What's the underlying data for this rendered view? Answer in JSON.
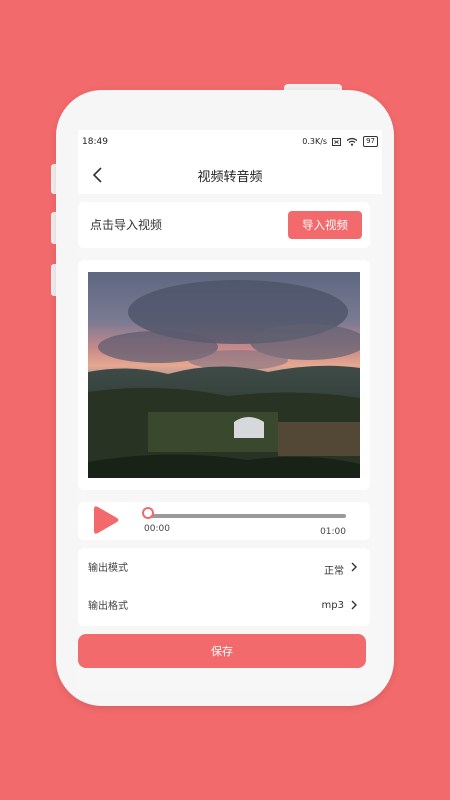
{
  "status_bar": {
    "time": "18:49",
    "speed": "0.3K/s",
    "battery": "97"
  },
  "nav": {
    "title": "视频转音频"
  },
  "import": {
    "label": "点击导入视频",
    "button": "导入视频"
  },
  "player": {
    "current_time": "00:00",
    "total_time": "01:00",
    "progress": 0
  },
  "settings": [
    {
      "label": "输出模式",
      "value": "正常"
    },
    {
      "label": "输出格式",
      "value": "mp3"
    }
  ],
  "save": {
    "label": "保存"
  },
  "colors": {
    "accent": "#f26a6c",
    "background": "#f26a6c",
    "card": "#ffffff"
  },
  "icons": [
    "back-arrow-icon",
    "wifi-icon",
    "battery-icon",
    "play-icon",
    "chevron-right-icon"
  ]
}
